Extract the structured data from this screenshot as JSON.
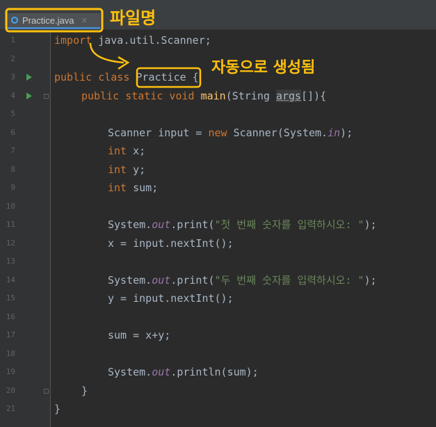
{
  "tab": {
    "title": "Practice.java",
    "close_glyph": "×"
  },
  "annotations": {
    "file_name": "파일명",
    "auto_generated": "자동으로 생성됨",
    "color": "#ffc10e"
  },
  "colors": {
    "keyword": "#cc7832",
    "string": "#6a8759",
    "field": "#9876aa",
    "method": "#ffc66d",
    "text": "#a9b7c6",
    "run": "#499c54"
  },
  "line_numbers": [
    "1",
    "2",
    "3",
    "4",
    "5",
    "6",
    "7",
    "8",
    "9",
    "10",
    "11",
    "12",
    "13",
    "14",
    "15",
    "16",
    "17",
    "18",
    "19",
    "20",
    "21"
  ],
  "code": {
    "l1": {
      "kw": "import",
      "rest": " java.util.Scanner;"
    },
    "l3": {
      "kw": "public class",
      "cls": "Practice",
      "rest": " {"
    },
    "l4": {
      "kw": "public static void",
      "fn": "main",
      "pre": "(String ",
      "args": "args",
      "post": "[]){"
    },
    "l6": {
      "a": "Scanner input = ",
      "kw": "new",
      "b": " Scanner(System.",
      "fld": "in",
      "c": ");"
    },
    "l7": {
      "kw": "int",
      "rest": " x;"
    },
    "l8": {
      "kw": "int",
      "rest": " y;"
    },
    "l9": {
      "kw": "int",
      "rest": " sum;"
    },
    "l11": {
      "a": "System.",
      "fld": "out",
      "b": ".print(",
      "str": "\"첫 번째 숫자를 입력하시오: \"",
      "c": ");"
    },
    "l12": {
      "text": "x = input.nextInt();"
    },
    "l14": {
      "a": "System.",
      "fld": "out",
      "b": ".print(",
      "str": "\"두 번째 숫자를 입력하시오: \"",
      "c": ");"
    },
    "l15": {
      "text": "y = input.nextInt();"
    },
    "l17": {
      "text": "sum = x+y;"
    },
    "l19": {
      "a": "System.",
      "fld": "out",
      "b": ".println(sum);"
    },
    "l20": {
      "text": "}"
    },
    "l21": {
      "text": "}"
    }
  }
}
